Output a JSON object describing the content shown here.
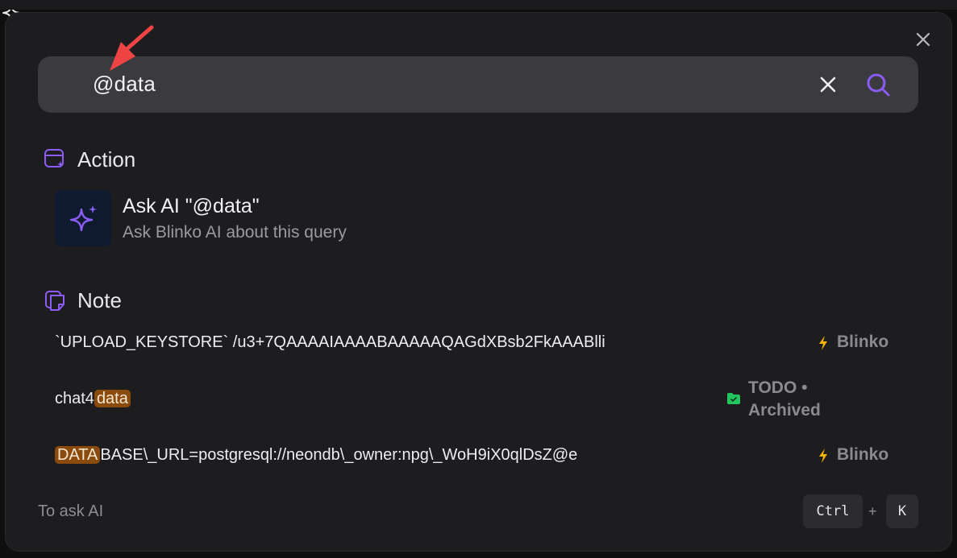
{
  "search": {
    "query": "@data"
  },
  "sections": {
    "action_title": "Action",
    "note_title": "Note"
  },
  "action": {
    "title": "Ask AI \"@data\"",
    "subtitle": "Ask Blinko AI about this query"
  },
  "notes": [
    {
      "text_plain": "`UPLOAD_KEYSTORE` /u3+7QAAAAIAAAABAAAAAQAGdXBsb2FkAAABlli",
      "tag": "Blinko"
    },
    {
      "text_before": "chat4",
      "text_highlight": "data",
      "tag_line1": "TODO •",
      "tag_line2": "Archived"
    },
    {
      "text_highlight": "DATA",
      "text_after": "BASE\\_URL=postgresql://neondb\\_owner:npg\\_WoH9iX0qlDsZ@e",
      "tag": "Blinko"
    }
  ],
  "footer": {
    "hint": "To ask AI",
    "key1": "Ctrl",
    "plus": "+",
    "key2": "K"
  },
  "colors": {
    "accent_purple": "#8b5cf6",
    "highlight": "#8a4b0c",
    "blinko_bolt": "#f5b400",
    "todo_folder": "#22c55e",
    "annotation_arrow": "#ef4444"
  },
  "icons": {
    "search_bar_left": "sparkle-icon",
    "clear": "close-icon",
    "search_button": "search-icon",
    "action_section": "window-sparkle-icon",
    "note_section": "notes-icon",
    "blinko_tag": "bolt-icon",
    "todo_tag": "folder-check-icon"
  }
}
